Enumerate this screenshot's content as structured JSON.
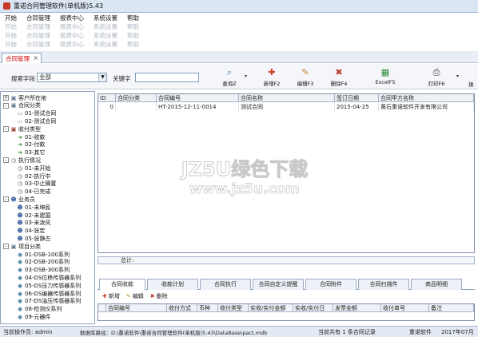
{
  "window": {
    "title": "重诺合同管理软件(单机版)5.43"
  },
  "menu": {
    "items": [
      "开始",
      "合同管理",
      "报表中心",
      "系统设置",
      "帮助"
    ]
  },
  "doc_tab": {
    "label": "合同管理",
    "close": "×"
  },
  "toolbar": {
    "search_field_label": "搜索字段",
    "search_field_value": "全部",
    "keyword_label": "关键字",
    "buttons": {
      "query": "查询Z",
      "add": "新增F2",
      "edit": "编辑F3",
      "delete": "删除F4",
      "excel": "ExcelF5",
      "print": "打印F6",
      "more": "操"
    }
  },
  "tree": {
    "nodes": [
      {
        "label": "客户所在地",
        "level": 0,
        "pm": "+",
        "icon": "folder-icon",
        "glyph": "▣",
        "color": "#5b6e8c"
      },
      {
        "label": "合同分类",
        "level": 0,
        "pm": "-",
        "icon": "folder-icon",
        "glyph": "▣",
        "color": "#5b6e8c"
      },
      {
        "label": "01-测试合同",
        "level": 1,
        "icon": "document-icon",
        "glyph": "▭",
        "color": "#8a8a8a"
      },
      {
        "label": "02-测试合同",
        "level": 1,
        "icon": "document-icon",
        "glyph": "▭",
        "color": "#8a8a8a"
      },
      {
        "label": "收付类型",
        "level": 0,
        "pm": "-",
        "icon": "category-icon",
        "glyph": "▣",
        "color": "#9a3a2a"
      },
      {
        "label": "01-收款",
        "level": 1,
        "icon": "arrow-icon",
        "glyph": "➜",
        "color": "#2d7d2d"
      },
      {
        "label": "02-付款",
        "level": 1,
        "icon": "arrow-icon",
        "glyph": "➜",
        "color": "#2d7d2d"
      },
      {
        "label": "03-其它",
        "level": 1,
        "icon": "arrow-icon",
        "glyph": "➜",
        "color": "#2d7d2d"
      },
      {
        "label": "执行情况",
        "level": 0,
        "pm": "-",
        "icon": "clock-icon",
        "glyph": "◷",
        "color": "#555"
      },
      {
        "label": "01-未开始",
        "level": 1,
        "icon": "clock-icon",
        "glyph": "◷",
        "color": "#555"
      },
      {
        "label": "02-执行中",
        "level": 1,
        "icon": "clock-icon",
        "glyph": "◷",
        "color": "#555"
      },
      {
        "label": "03-中止搁置",
        "level": 1,
        "icon": "clock-icon",
        "glyph": "◷",
        "color": "#555"
      },
      {
        "label": "04-已完成",
        "level": 1,
        "icon": "clock-icon",
        "glyph": "◷",
        "color": "#555"
      },
      {
        "label": "业务员",
        "level": 0,
        "pm": "-",
        "icon": "users-icon",
        "glyph": "☻",
        "color": "#3a5fa0"
      },
      {
        "label": "01-未坤民",
        "level": 1,
        "icon": "user-icon",
        "glyph": "☻",
        "color": "#3a5fa0"
      },
      {
        "label": "02-未建国",
        "level": 1,
        "icon": "user-icon",
        "glyph": "☻",
        "color": "#3a5fa0"
      },
      {
        "label": "03-未泼风",
        "level": 1,
        "icon": "user-icon",
        "glyph": "☻",
        "color": "#3a5fa0"
      },
      {
        "label": "04-张宏",
        "level": 1,
        "icon": "user-icon",
        "glyph": "☻",
        "color": "#3a5fa0"
      },
      {
        "label": "05-张静古",
        "level": 1,
        "icon": "user-icon",
        "glyph": "☻",
        "color": "#3a5fa0"
      },
      {
        "label": "项目分类",
        "level": 0,
        "pm": "-",
        "icon": "folder-icon",
        "glyph": "▣",
        "color": "#5b6e8c"
      },
      {
        "label": "01-DSB-100系列",
        "level": 1,
        "icon": "item-icon",
        "glyph": "◉",
        "color": "#3a7a9a"
      },
      {
        "label": "02-DSB-200系列",
        "level": 1,
        "icon": "item-icon",
        "glyph": "◉",
        "color": "#3a7a9a"
      },
      {
        "label": "03-DSB-300系列",
        "level": 1,
        "icon": "item-icon",
        "glyph": "◉",
        "color": "#3a7a9a"
      },
      {
        "label": "04-DS位移传感器系列",
        "level": 1,
        "icon": "item-icon",
        "glyph": "◉",
        "color": "#3a7a9a"
      },
      {
        "label": "05-DS压力传感器系列",
        "level": 1,
        "icon": "item-icon",
        "glyph": "◉",
        "color": "#3a7a9a"
      },
      {
        "label": "06-DS编器传感器系列",
        "level": 1,
        "icon": "item-icon",
        "glyph": "◉",
        "color": "#3a7a9a"
      },
      {
        "label": "07-DS油压传感器系列",
        "level": 1,
        "icon": "item-icon",
        "glyph": "◉",
        "color": "#3a7a9a"
      },
      {
        "label": "08-检测仪系列",
        "level": 1,
        "icon": "item-icon",
        "glyph": "◉",
        "color": "#3a7a9a"
      },
      {
        "label": "09-元器件",
        "level": 1,
        "icon": "item-icon",
        "glyph": "◉",
        "color": "#3a7a9a"
      }
    ]
  },
  "grid": {
    "headers": [
      "ID",
      "合同分类",
      "合同编号",
      "合同名称",
      "签订日期",
      "合同甲方名称"
    ],
    "rows": [
      [
        "0",
        "",
        "HT-2015-12-11-0014",
        "测试合同",
        "2015-04-25",
        "黄石重诺软件开发有限公司"
      ]
    ],
    "total_label": "总计:"
  },
  "bottom_tabs": [
    "合同收款",
    "收款计划",
    "合同执行",
    "合同自定义提醒",
    "合同附件",
    "合同扫描件",
    "商品明细"
  ],
  "bottom_toolbar": {
    "add": "新增",
    "edit": "编辑",
    "delete": "删除"
  },
  "bottom_grid": {
    "headers": [
      "合同编号",
      "收付方式",
      "币种",
      "收付类型",
      "实收/实付金额",
      "实收/实付日",
      "发票金额",
      "收付单号",
      "备注"
    ]
  },
  "status": {
    "operator": "当前操作员: admin",
    "db_path": "数据库路径：D:\\重诺软件\\重诺合同管理软件(单机版)5.43\\DataBase\\pact.mdb",
    "count": "当前共有 1 条合同记录",
    "brand": "重诺软件",
    "date": "2017年07月"
  },
  "watermark": {
    "main": "JZ5U绿色下载",
    "url": "www.jz5u.com"
  }
}
